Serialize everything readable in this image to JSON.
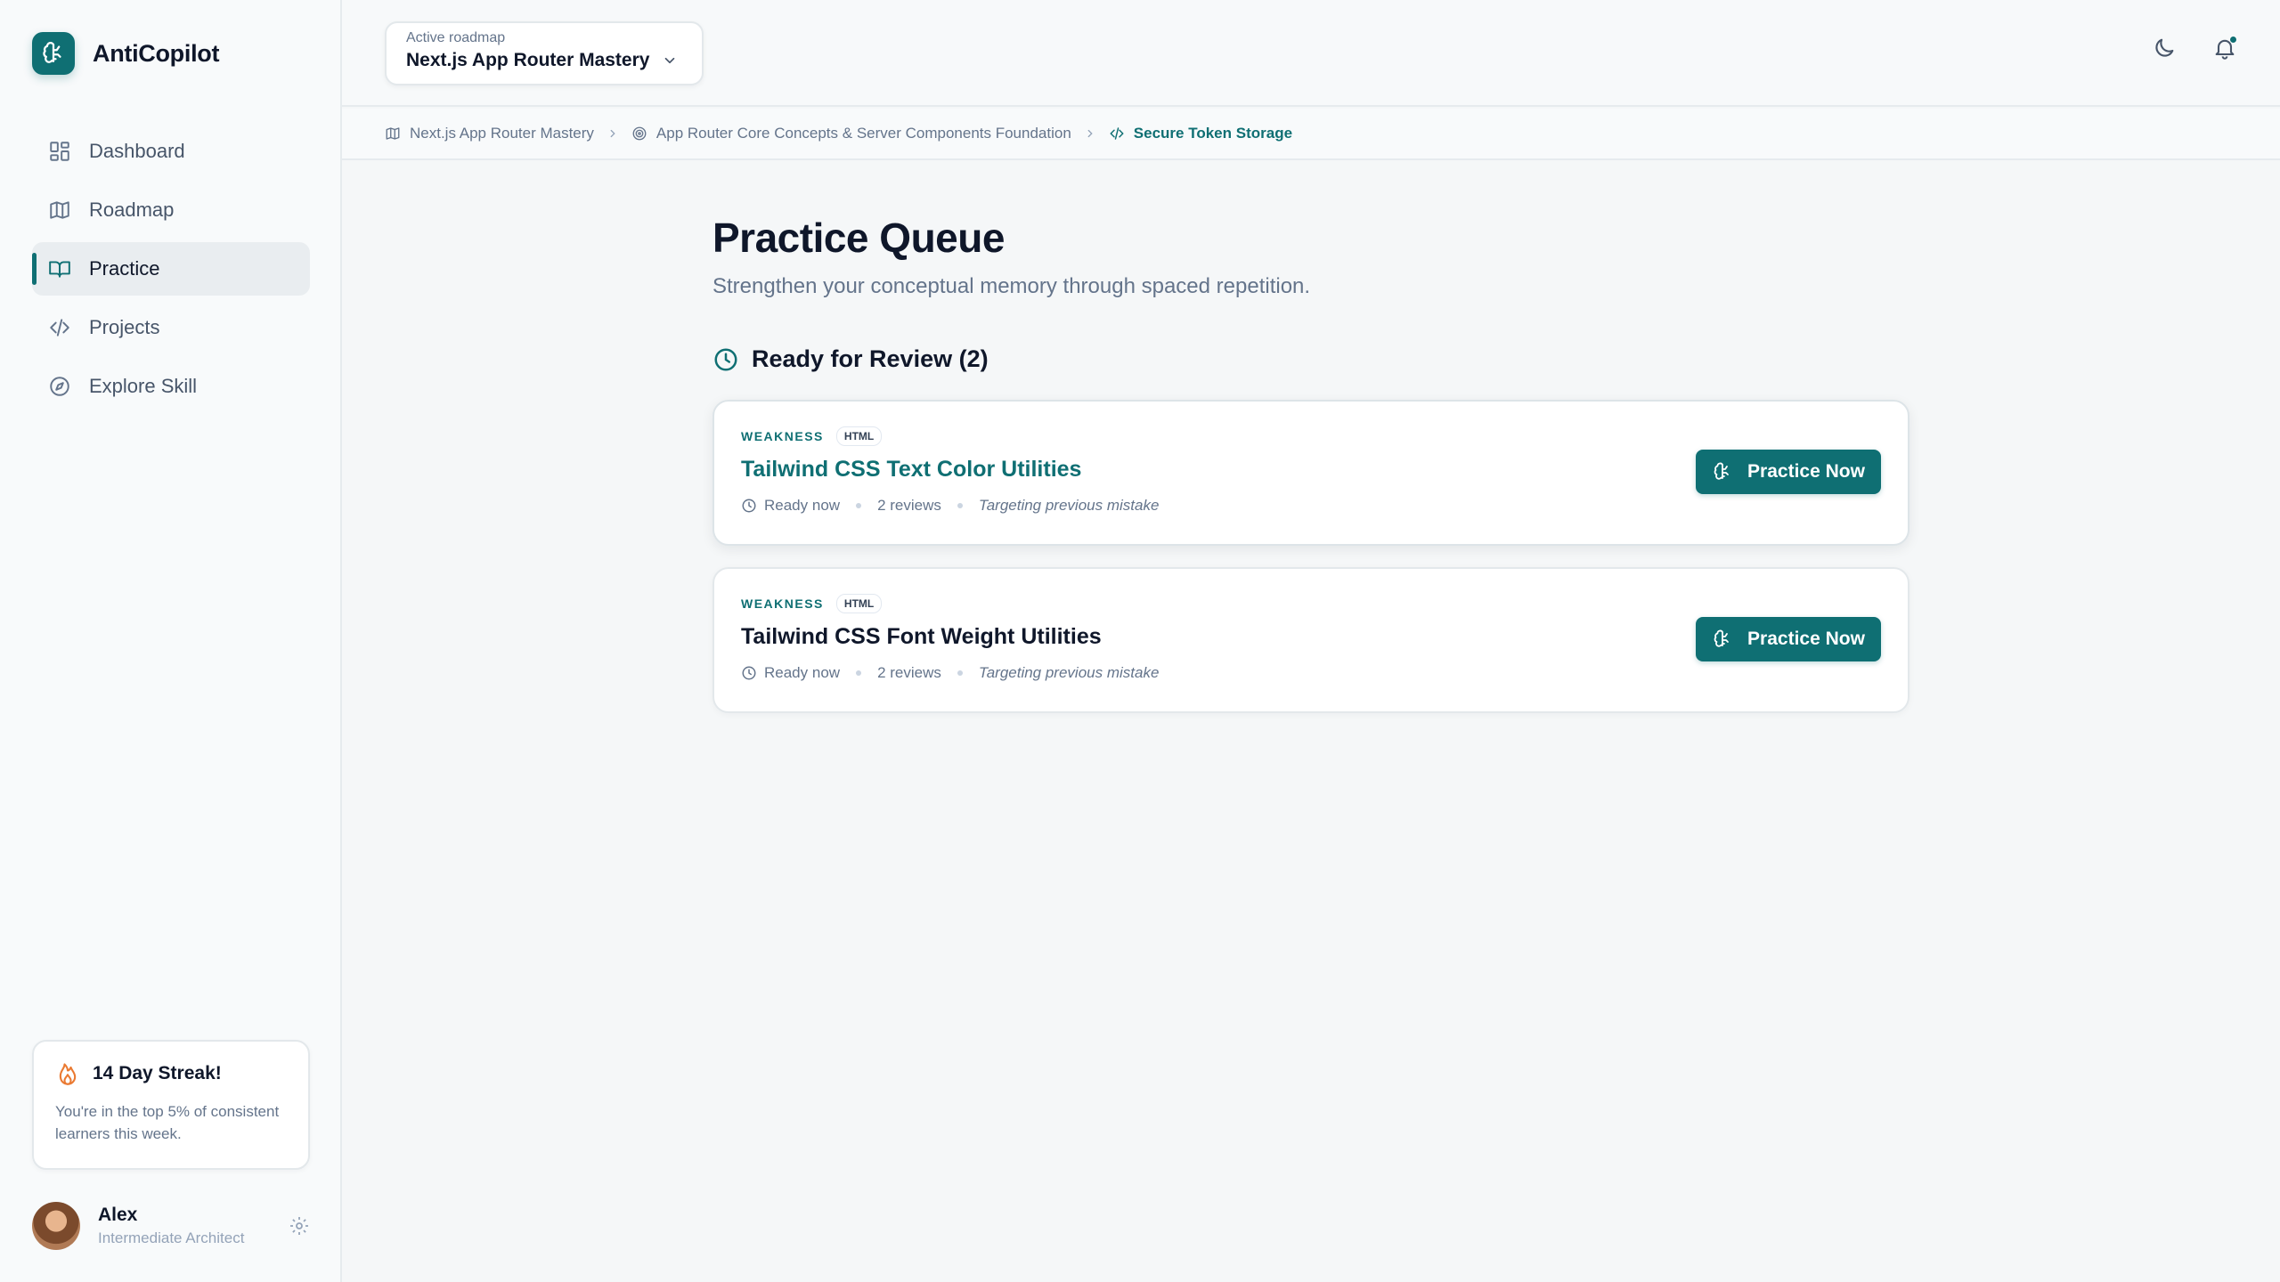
{
  "app": {
    "name": "AntiCopilot"
  },
  "sidebar": {
    "items": [
      {
        "label": "Dashboard",
        "icon": "dashboard-icon"
      },
      {
        "label": "Roadmap",
        "icon": "map-icon"
      },
      {
        "label": "Practice",
        "icon": "book-open-icon",
        "active": true
      },
      {
        "label": "Projects",
        "icon": "code-icon"
      },
      {
        "label": "Explore Skill",
        "icon": "compass-icon"
      }
    ],
    "streak": {
      "title": "14 Day Streak!",
      "description": "You're in the top 5% of consistent learners this week."
    },
    "user": {
      "name": "Alex",
      "role": "Intermediate Architect"
    }
  },
  "header": {
    "roadmap_label": "Active roadmap",
    "roadmap_value": "Next.js App Router Mastery"
  },
  "breadcrumb": {
    "items": [
      "Next.js App Router Mastery",
      "App Router Core Concepts & Server Components Foundation",
      "Secure Token Storage"
    ]
  },
  "main": {
    "title": "Practice Queue",
    "subtitle": "Strengthen your conceptual memory through spaced repetition.",
    "section_title": "Ready for Review (2)",
    "cards": [
      {
        "tag": "WEAKNESS",
        "badge": "HTML",
        "title": "Tailwind CSS Text Color Utilities",
        "status": "Ready now",
        "reviews": "2 reviews",
        "note": "Targeting previous mistake",
        "button": "Practice Now"
      },
      {
        "tag": "WEAKNESS",
        "badge": "HTML",
        "title": "Tailwind CSS Font Weight Utilities",
        "status": "Ready now",
        "reviews": "2 reviews",
        "note": "Targeting previous mistake",
        "button": "Practice Now"
      }
    ]
  },
  "colors": {
    "accent": "#0f6f73",
    "streak": "#ea7a32"
  }
}
